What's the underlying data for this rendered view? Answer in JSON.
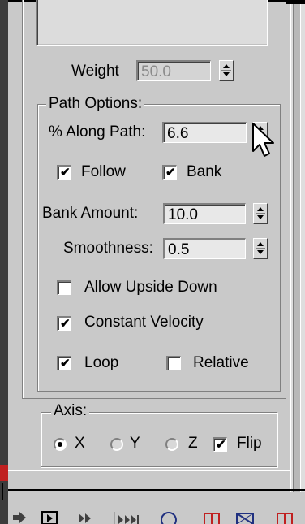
{
  "weight": {
    "label": "Weight",
    "value": "50.0"
  },
  "path_options": {
    "title": "Path Options:",
    "along_path": {
      "label": "% Along Path:",
      "value": "6.6"
    },
    "follow": {
      "label": "Follow",
      "checked": true
    },
    "bank": {
      "label": "Bank",
      "checked": true
    },
    "bank_amount": {
      "label": "Bank Amount:",
      "value": "10.0"
    },
    "smoothness": {
      "label": "Smoothness:",
      "value": "0.5"
    },
    "allow_upside_down": {
      "label": "Allow Upside Down",
      "checked": false
    },
    "constant_velocity": {
      "label": "Constant Velocity",
      "checked": true
    },
    "loop": {
      "label": "Loop",
      "checked": true
    },
    "relative": {
      "label": "Relative",
      "checked": false
    }
  },
  "axis": {
    "title": "Axis:",
    "x": {
      "label": "X",
      "selected": true
    },
    "y": {
      "label": "Y",
      "selected": false
    },
    "z": {
      "label": "Z",
      "selected": false
    },
    "flip": {
      "label": "Flip",
      "checked": true
    }
  },
  "check_glyph": "✔",
  "icons": [
    "key-mode-icon",
    "play-icon",
    "next-frame-icon",
    "go-to-end-icon",
    "zoom-icon",
    "region-zoom-icon",
    "field-of-view-icon",
    "maximize-viewport-icon"
  ],
  "colors": {
    "panel_bg": "#c9c9c9",
    "disabled_text": "#8a8a8a",
    "accent_red": "#c02020"
  }
}
